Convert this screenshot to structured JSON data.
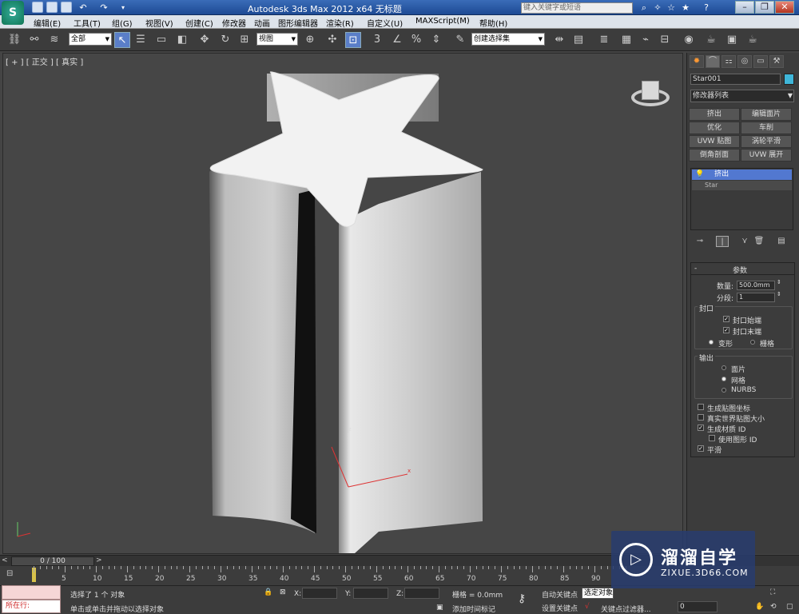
{
  "titlebar": {
    "title": "Autodesk 3ds Max  2012 x64      无标题",
    "search_placeholder": "键入关键字或短语"
  },
  "menu": [
    "编辑(E)",
    "工具(T)",
    "组(G)",
    "视图(V)",
    "创建(C)",
    "修改器",
    "动画",
    "图形编辑器",
    "渲染(R)",
    "自定义(U)",
    "MAXScript(M)",
    "帮助(H)"
  ],
  "toolbar": {
    "filter": "全部",
    "ref_coord": "视图",
    "selection_set": "创建选择集"
  },
  "viewport": {
    "label": "[ + ] [ 正交 ] [ 真实 ]",
    "axis_x": "x",
    "axis_z": "z"
  },
  "command_panel": {
    "object_name": "Star001",
    "modifier_list": "修改器列表",
    "modifier_buttons": [
      "挤出",
      "编辑面片",
      "优化",
      "车削",
      "UVW 贴图",
      "涡轮平滑",
      "倒角剖面",
      "UVW 展开"
    ],
    "stack_top": "挤出",
    "stack_base": "Star",
    "rollout_title": "参数",
    "amount_label": "数量:",
    "amount_value": "500.0mm",
    "segments_label": "分段:",
    "segments_value": "1",
    "capping_title": "封口",
    "cap_start": "封口始端",
    "cap_end": "封口末端",
    "morph": "变形",
    "grid": "栅格",
    "output_title": "输出",
    "out_patch": "面片",
    "out_mesh": "网格",
    "out_nurbs": "NURBS",
    "gen_map_coords": "生成贴图坐标",
    "real_world": "真实世界贴图大小",
    "gen_mat_ids": "生成材质 ID",
    "use_shape_ids": "使用图形 ID",
    "smooth": "平滑"
  },
  "timeline": {
    "slider": "0 / 100",
    "ticks": [
      "5",
      "10",
      "15",
      "20",
      "25",
      "30",
      "35",
      "40",
      "45",
      "50",
      "55",
      "60",
      "65",
      "70",
      "75",
      "80",
      "85",
      "90"
    ]
  },
  "status": {
    "running": "所在行:",
    "selection_msg": "选择了 1 个 对象",
    "prompt": "单击或单击并拖动以选择对象",
    "x_label": "X:",
    "y_label": "Y:",
    "z_label": "Z:",
    "grid": "栅格 = 0.0mm",
    "add_time_tag": "添加时间标记",
    "auto_key": "自动关键点",
    "selected": "选定对象",
    "set_key": "设置关键点",
    "key_filters": "关键点过滤器...",
    "frame": "0"
  },
  "watermark": {
    "brand": "溜溜自学",
    "url": "ZIXUE.3D66.COM"
  }
}
